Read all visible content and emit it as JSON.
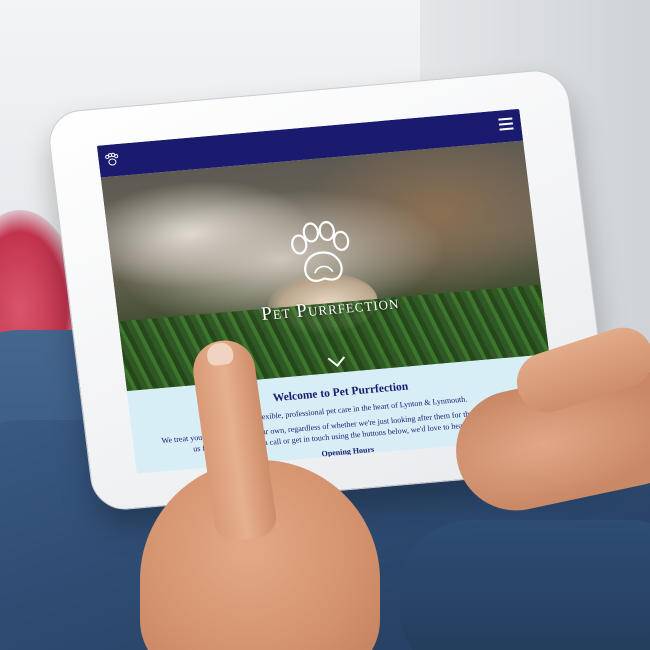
{
  "site": {
    "brand_name": "Pet Purrfection",
    "welcome_heading": "Welcome to Pet Purrfection",
    "intro_line": "We provide flexible, professional pet care in the heart of Lynton & Lynmouth.",
    "treat_line": "We treat your pets like one of our own, regardless of whether we're just looking after them for the day, or you need",
    "contact_line": "us for longer. Give us a call or get in touch using the buttons below, we'd love to hear from you.",
    "section_heading": "Opening Hours"
  },
  "icons": {
    "logo": "paw-print-icon",
    "menu": "hamburger-menu-icon",
    "scroll": "chevron-down-icon"
  },
  "colors": {
    "header_bg": "#1a1a6e",
    "content_bg": "#d7eef7",
    "text": "#1a1a6e"
  }
}
